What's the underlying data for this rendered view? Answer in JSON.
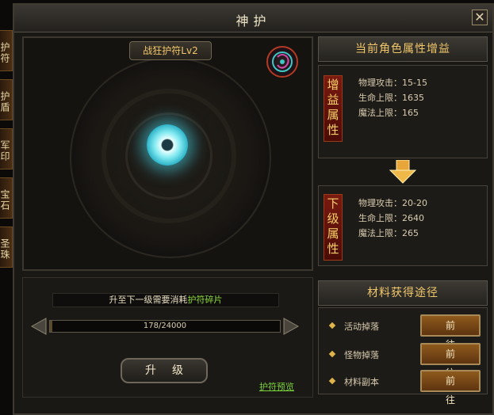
{
  "window": {
    "title": "神护",
    "close_glyph": "✕"
  },
  "side_tabs": [
    {
      "label": "护符"
    },
    {
      "label": "护盾"
    },
    {
      "label": "军印"
    },
    {
      "label": "宝石"
    },
    {
      "label": "圣珠"
    }
  ],
  "charm": {
    "name": "战狂护符Lv2"
  },
  "attributes": {
    "header": "当前角色属性增益",
    "gain_label": "增益属性",
    "gain": [
      "物理攻击：15-15",
      "生命上限：1635",
      "魔法上限：165"
    ],
    "next_label": "下级属性",
    "next": [
      "物理攻击：20-20",
      "生命上限：2640",
      "魔法上限：265"
    ]
  },
  "upgrade": {
    "cost_text": "升至下一级需要消耗",
    "cost_item": "护符碎片",
    "progress_text": "178/24000",
    "progress_fraction": 0.0074,
    "button_label": "升级",
    "preview_link": "护符预览"
  },
  "materials": {
    "header": "材料获得途径",
    "rows": [
      {
        "label": "活动掉落",
        "button": "前往"
      },
      {
        "label": "怪物掉落",
        "button": "前往"
      },
      {
        "label": "材料副本",
        "button": "前往"
      }
    ]
  }
}
